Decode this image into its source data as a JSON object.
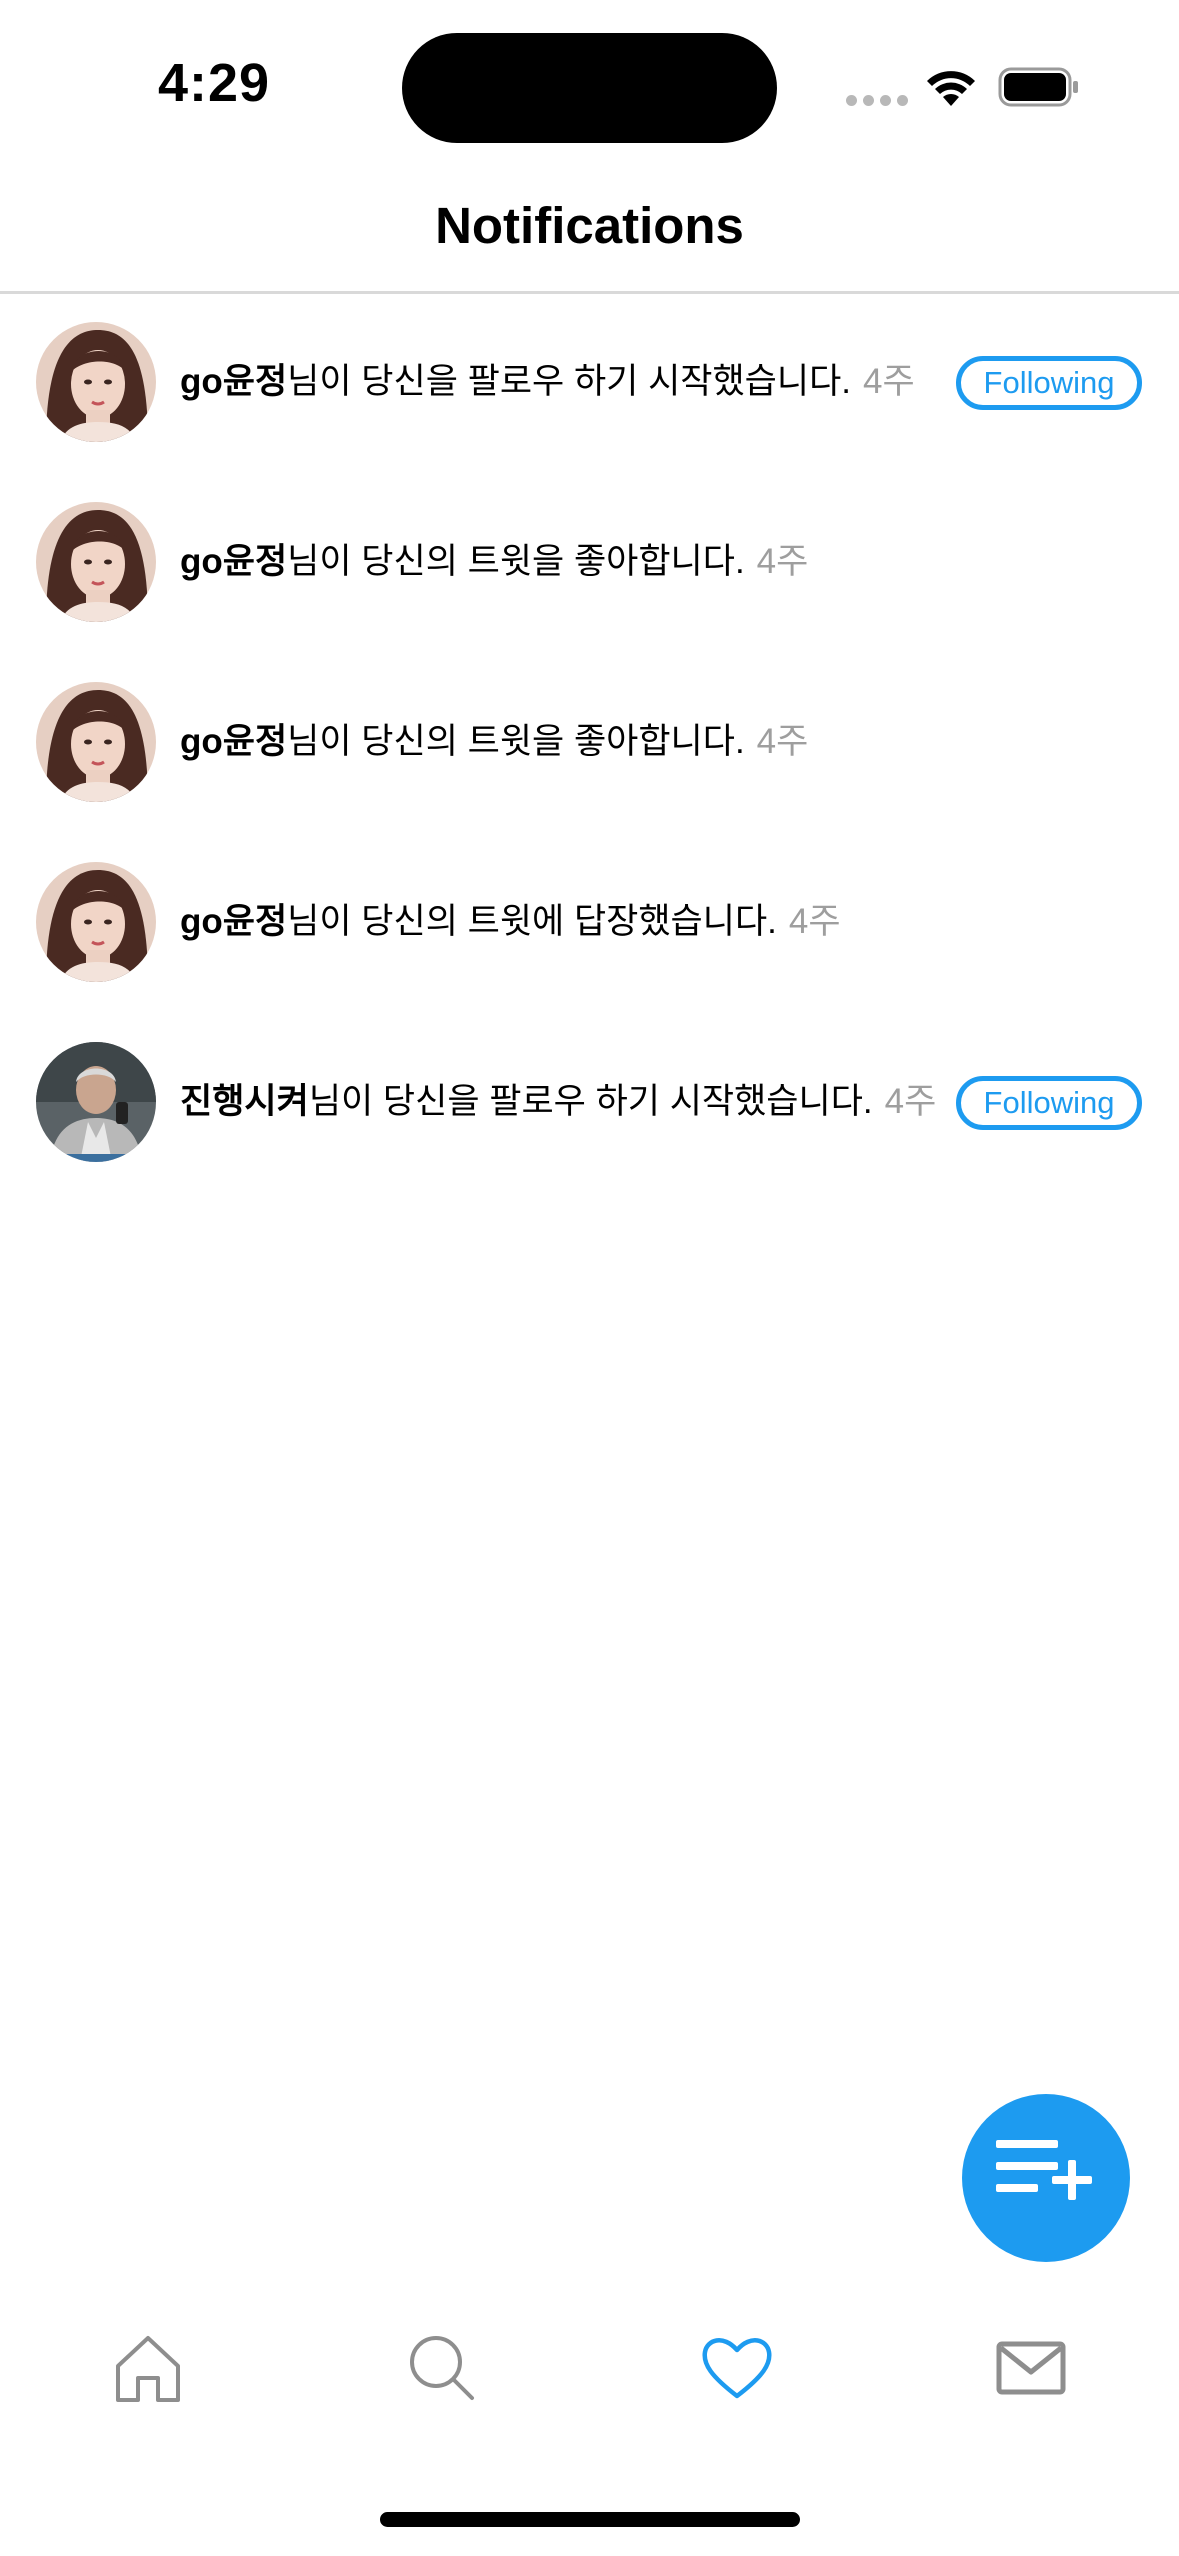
{
  "status_bar": {
    "time": "4:29"
  },
  "nav": {
    "title": "Notifications"
  },
  "notifications": [
    {
      "name": "go윤정",
      "message": "님이 당신을 팔로우 하기 시작했습니다.",
      "time": "4주",
      "button": "Following",
      "avatar": "avatar-woman"
    },
    {
      "name": "go윤정",
      "message": "님이 당신의 트윗을 좋아합니다.",
      "time": "4주",
      "avatar": "avatar-woman"
    },
    {
      "name": "go윤정",
      "message": "님이 당신의 트윗을 좋아합니다.",
      "time": "4주",
      "avatar": "avatar-woman"
    },
    {
      "name": "go윤정",
      "message": "님이 당신의 트윗에 답장했습니다.",
      "time": "4주",
      "avatar": "avatar-woman"
    },
    {
      "name": "진행시켜",
      "message": "님이 당신을 팔로우 하기 시작했습니다.",
      "time": "4주",
      "button": "Following",
      "avatar": "avatar-man"
    }
  ],
  "fab": {
    "icon": "compose-list-plus-icon"
  },
  "tab_bar": {
    "items": [
      {
        "icon": "home-icon",
        "active": false
      },
      {
        "icon": "search-icon",
        "active": false
      },
      {
        "icon": "heart-icon",
        "active": true
      },
      {
        "icon": "mail-icon",
        "active": false
      }
    ]
  },
  "colors": {
    "accent": "#1d9bf0",
    "secondary_text": "#9e9e9e",
    "inactive_icon": "#8e8e8e"
  }
}
